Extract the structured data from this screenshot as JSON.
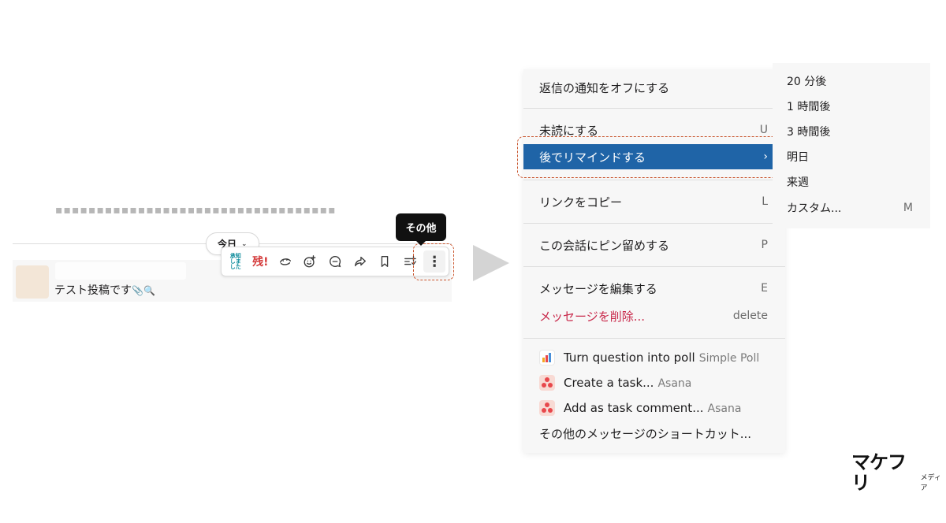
{
  "message_area": {
    "date_label": "今日",
    "message_text": "テスト投稿です",
    "message_emoji": "📎🔍",
    "more_tooltip": "その他",
    "reaction_stamp_1": "承知しました",
    "reaction_stamp_2": "残!",
    "toolbar_icons": [
      "stamp-known-icon",
      "stamp-zan-icon",
      "stamp-face-icon",
      "add-reaction-icon",
      "reply-in-thread-icon",
      "share-icon",
      "bookmark-icon",
      "add-to-list-icon",
      "more-actions-icon"
    ]
  },
  "menu": {
    "items": [
      {
        "label": "返信の通知をオフにする",
        "shortcut": ""
      },
      {
        "label": "未読にする",
        "shortcut": "U"
      },
      {
        "label": "後でリマインドする",
        "shortcut": "›"
      },
      {
        "label": "リンクをコピー",
        "shortcut": "L"
      },
      {
        "label": "この会話にピン留めする",
        "shortcut": "P"
      },
      {
        "label": "メッセージを編集する",
        "shortcut": "E"
      },
      {
        "label": "メッセージを削除...",
        "shortcut": "delete"
      }
    ],
    "apps": [
      {
        "label": "Turn question into poll",
        "source": "Simple Poll"
      },
      {
        "label": "Create a task...",
        "source": "Asana"
      },
      {
        "label": "Add as task comment...",
        "source": "Asana"
      }
    ],
    "more_shortcuts": "その他のメッセージのショートカット..."
  },
  "submenu": {
    "items": [
      {
        "label": "20 分後",
        "shortcut": ""
      },
      {
        "label": "1 時間後",
        "shortcut": ""
      },
      {
        "label": "3 時間後",
        "shortcut": ""
      },
      {
        "label": "明日",
        "shortcut": ""
      },
      {
        "label": "来週",
        "shortcut": ""
      },
      {
        "label": "カスタム...",
        "shortcut": "M"
      }
    ]
  },
  "logo": {
    "main": "マケフリ",
    "sub": "メディア"
  },
  "colors": {
    "active_item": "#1f64a7",
    "danger_text": "#c8284a",
    "highlight_dash": "#c8532b"
  }
}
